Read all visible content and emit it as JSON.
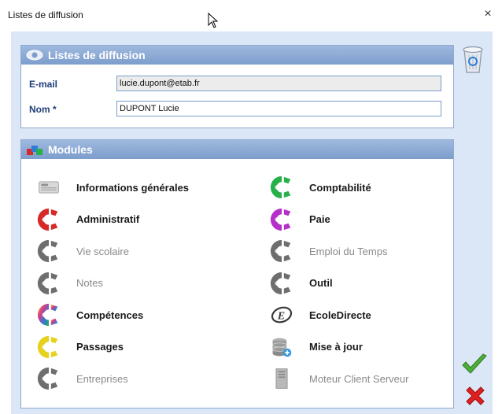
{
  "window": {
    "title": "Listes de diffusion",
    "close_label": "×"
  },
  "panel_diffusion": {
    "title": "Listes de diffusion",
    "email_label": "E-mail",
    "email_value": "lucie.dupont@etab.fr",
    "nom_label": "Nom *",
    "nom_value": "DUPONT Lucie"
  },
  "panel_modules": {
    "title": "Modules",
    "left": [
      {
        "label": "Informations générales",
        "icon": "news-icon",
        "enabled": true
      },
      {
        "label": "Administratif",
        "icon": "module-red-icon",
        "color": "#d62a2a",
        "enabled": true
      },
      {
        "label": "Vie scolaire",
        "icon": "module-grey-icon",
        "color": "#6e6e6e",
        "enabled": false
      },
      {
        "label": "Notes",
        "icon": "module-grey-icon",
        "color": "#6e6e6e",
        "enabled": false
      },
      {
        "label": "Compétences",
        "icon": "module-rainbow-icon",
        "color": "#d63a8a",
        "enabled": true
      },
      {
        "label": "Passages",
        "icon": "module-yellow-icon",
        "color": "#e6d21e",
        "enabled": true
      },
      {
        "label": "Entreprises",
        "icon": "module-grey-icon",
        "color": "#6e6e6e",
        "enabled": false
      }
    ],
    "right": [
      {
        "label": "Comptabilité",
        "icon": "module-green-icon",
        "color": "#26b04a",
        "enabled": true
      },
      {
        "label": "Paie",
        "icon": "module-purple-icon",
        "color": "#b52fc9",
        "enabled": true
      },
      {
        "label": "Emploi du Temps",
        "icon": "module-grey-icon",
        "color": "#6e6e6e",
        "enabled": false
      },
      {
        "label": "Outil",
        "icon": "module-grey-icon",
        "color": "#6e6e6e",
        "enabled": true
      },
      {
        "label": "EcoleDirecte",
        "icon": "ecoledirecte-icon",
        "enabled": true
      },
      {
        "label": "Mise à jour",
        "icon": "database-icon",
        "enabled": true
      },
      {
        "label": "Moteur Client Serveur",
        "icon": "server-icon",
        "enabled": false
      }
    ]
  },
  "colors": {
    "accent": "#7d9dcc",
    "label": "#1f3d7a",
    "bg": "#dbe7f6"
  }
}
